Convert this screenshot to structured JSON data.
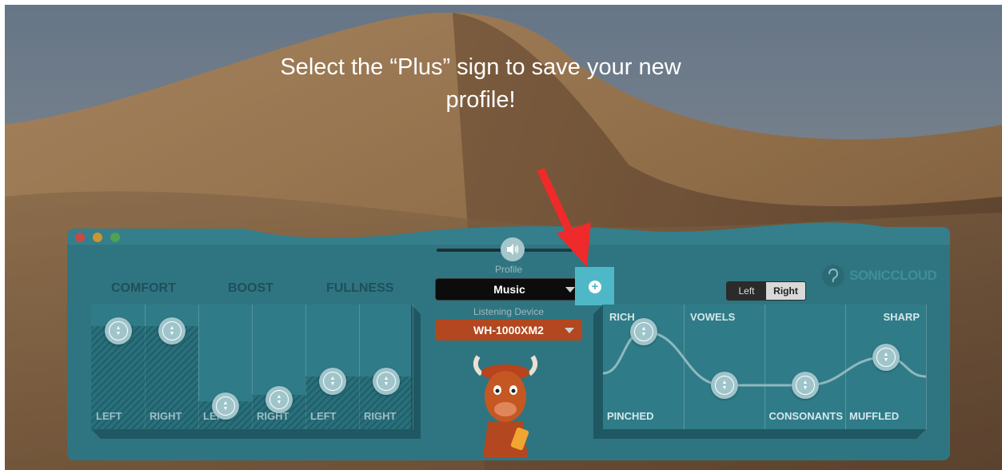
{
  "instruction": {
    "line1": "Select the “Plus” sign to save your new",
    "line2": "profile!"
  },
  "window_controls": [
    {
      "name": "close",
      "color": "#d9534f"
    },
    {
      "name": "minimize",
      "color": "#d9a23a"
    },
    {
      "name": "zoom",
      "color": "#5cb85c"
    }
  ],
  "volume_icon": "speaker-icon",
  "profile": {
    "label": "Profile",
    "selected": "Music",
    "add_icon": "plus-icon"
  },
  "listening_device": {
    "label": "Listening Device",
    "selected": "WH-1000XM2"
  },
  "headers": {
    "comfort": "COMFORT",
    "boost": "BOOST",
    "fullness": "FULLNESS"
  },
  "sliders": [
    {
      "group": "comfort",
      "side": "LEFT",
      "level": 0.85
    },
    {
      "group": "comfort",
      "side": "RIGHT",
      "level": 0.85
    },
    {
      "group": "boost",
      "side": "LEFT",
      "level": 0.25
    },
    {
      "group": "boost",
      "side": "RIGHT",
      "level": 0.3
    },
    {
      "group": "fullness",
      "side": "LEFT",
      "level": 0.45
    },
    {
      "group": "fullness",
      "side": "RIGHT",
      "level": 0.45
    }
  ],
  "ear_toggle": {
    "left": "Left",
    "right": "Right",
    "active": "Right"
  },
  "brand": {
    "name": "SONICCLOUD",
    "icon": "ear-icon"
  },
  "eq": {
    "top_labels": [
      "RICH",
      "VOWELS",
      "",
      "SHARP"
    ],
    "bottom_labels": [
      "PINCHED",
      "",
      "CONSONANTS",
      "MUFFLED"
    ],
    "levels": [
      0.78,
      0.35,
      0.35,
      0.58
    ]
  },
  "colors": {
    "accent": "#4fb8c6",
    "arrow": "#ef2a2a",
    "panel": "#2f7c88",
    "device_dropdown": "#b3471f"
  }
}
